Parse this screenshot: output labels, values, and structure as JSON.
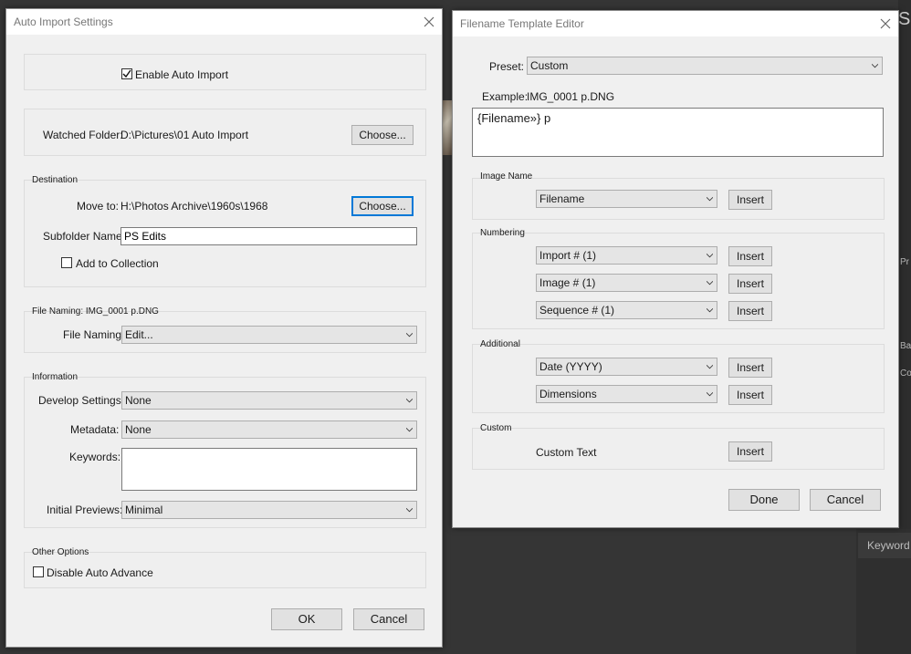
{
  "background": {
    "right_letter": "Sl",
    "keyword_tab": "Keyword",
    "partial_right_1": "Pr",
    "partial_right_2": "Ba",
    "partial_right_3": "Co"
  },
  "auto_import": {
    "title": "Auto Import Settings",
    "enable_label": "Enable Auto Import",
    "enable_checked": true,
    "watched_folder_label": "Watched Folder:",
    "watched_folder_value": "D:\\Pictures\\01 Auto Import",
    "choose_label": "Choose...",
    "destination_title": "Destination",
    "move_to_label": "Move to:",
    "move_to_value": "H:\\Photos Archive\\1960s\\1968",
    "subfolder_label": "Subfolder Name:",
    "subfolder_value": "PS Edits",
    "add_collection_label": "Add to Collection",
    "add_collection_checked": false,
    "file_naming_title": "File Naming:  IMG_0001 p.DNG",
    "file_naming_label": "File Naming:",
    "file_naming_value": "Edit...",
    "information_title": "Information",
    "develop_label": "Develop Settings:",
    "develop_value": "None",
    "metadata_label": "Metadata:",
    "metadata_value": "None",
    "keywords_label": "Keywords:",
    "keywords_value": "",
    "previews_label": "Initial Previews:",
    "previews_value": "Minimal",
    "other_title": "Other Options",
    "disable_advance_label": "Disable Auto Advance",
    "disable_advance_checked": false,
    "ok_label": "OK",
    "cancel_label": "Cancel"
  },
  "template_editor": {
    "title": "Filename Template Editor",
    "preset_label": "Preset:",
    "preset_value": "Custom",
    "example_label": "Example:",
    "example_value": "IMG_0001 p.DNG",
    "template_text": "{Filename»} p",
    "image_name_title": "Image Name",
    "image_name_value": "Filename",
    "numbering_title": "Numbering",
    "import_num_value": "Import # (1)",
    "image_num_value": "Image # (1)",
    "sequence_num_value": "Sequence # (1)",
    "additional_title": "Additional",
    "date_value": "Date (YYYY)",
    "dimensions_value": "Dimensions",
    "custom_title": "Custom",
    "custom_text_label": "Custom Text",
    "insert_label": "Insert",
    "done_label": "Done",
    "cancel_label": "Cancel"
  }
}
